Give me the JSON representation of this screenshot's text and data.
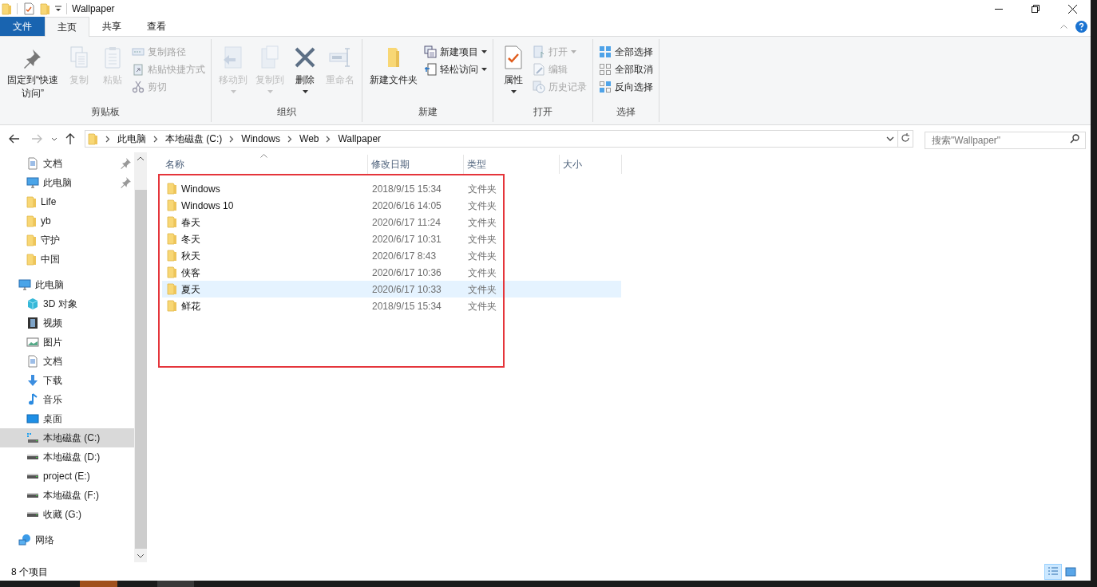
{
  "window": {
    "title": "Wallpaper"
  },
  "ribbon": {
    "tabs": [
      {
        "label": "文件",
        "kind": "file",
        "selected": false
      },
      {
        "label": "主页",
        "kind": "tab",
        "selected": true
      },
      {
        "label": "共享",
        "kind": "tab",
        "selected": false
      },
      {
        "label": "查看",
        "kind": "tab",
        "selected": false
      }
    ],
    "groups": [
      {
        "label": "剪贴板",
        "commands": [
          {
            "label": "固定到“快速访问”",
            "kind": "large",
            "disabled": false,
            "dropdown": false
          },
          {
            "label": "复制",
            "kind": "large",
            "disabled": true,
            "dropdown": false
          },
          {
            "label": "粘贴",
            "kind": "large",
            "disabled": true,
            "dropdown": false
          },
          {
            "label": "复制路径",
            "kind": "small",
            "disabled": true,
            "dropdown": false
          },
          {
            "label": "粘贴快捷方式",
            "kind": "small",
            "disabled": true,
            "dropdown": false
          },
          {
            "label": "剪切",
            "kind": "small",
            "disabled": true,
            "dropdown": false
          }
        ]
      },
      {
        "label": "组织",
        "commands": [
          {
            "label": "移动到",
            "kind": "large",
            "disabled": true,
            "dropdown": true
          },
          {
            "label": "复制到",
            "kind": "large",
            "disabled": true,
            "dropdown": true
          },
          {
            "label": "删除",
            "kind": "large",
            "disabled": false,
            "dropdown": true
          },
          {
            "label": "重命名",
            "kind": "large",
            "disabled": true,
            "dropdown": false
          }
        ]
      },
      {
        "label": "新建",
        "commands": [
          {
            "label": "新建文件夹",
            "kind": "large",
            "disabled": false,
            "dropdown": false
          },
          {
            "label": "新建项目",
            "kind": "small",
            "disabled": false,
            "dropdown": true
          },
          {
            "label": "轻松访问",
            "kind": "small",
            "disabled": false,
            "dropdown": true
          }
        ]
      },
      {
        "label": "打开",
        "commands": [
          {
            "label": "属性",
            "kind": "large",
            "disabled": false,
            "dropdown": true
          },
          {
            "label": "打开",
            "kind": "small",
            "disabled": true,
            "dropdown": true
          },
          {
            "label": "编辑",
            "kind": "small",
            "disabled": true,
            "dropdown": false
          },
          {
            "label": "历史记录",
            "kind": "small",
            "disabled": true,
            "dropdown": false
          }
        ]
      },
      {
        "label": "选择",
        "commands": [
          {
            "label": "全部选择",
            "kind": "small",
            "disabled": false,
            "dropdown": false
          },
          {
            "label": "全部取消",
            "kind": "small",
            "disabled": false,
            "dropdown": false
          },
          {
            "label": "反向选择",
            "kind": "small",
            "disabled": false,
            "dropdown": false
          }
        ]
      }
    ]
  },
  "address": {
    "path": [
      "此电脑",
      "本地磁盘 (C:)",
      "Windows",
      "Web",
      "Wallpaper"
    ],
    "search_placeholder": "搜索\"Wallpaper\""
  },
  "sidebar": {
    "quick_access": [
      {
        "label": "文档",
        "kind": "document",
        "pinned": true,
        "selected": false
      },
      {
        "label": "此电脑",
        "kind": "computer",
        "pinned": true,
        "selected": false
      },
      {
        "label": "Life",
        "kind": "folder",
        "pinned": false,
        "selected": false
      },
      {
        "label": "yb",
        "kind": "folder",
        "pinned": false,
        "selected": false
      },
      {
        "label": "守护",
        "kind": "folder",
        "pinned": false,
        "selected": false
      },
      {
        "label": "中国",
        "kind": "folder",
        "pinned": false,
        "selected": false
      }
    ],
    "items": [
      {
        "label": "此电脑",
        "kind": "computer",
        "selected": false,
        "children": [
          {
            "label": "3D 对象",
            "kind": "cube",
            "selected": false
          },
          {
            "label": "视频",
            "kind": "video",
            "selected": false
          },
          {
            "label": "图片",
            "kind": "picture",
            "selected": false
          },
          {
            "label": "文档",
            "kind": "document",
            "selected": false
          },
          {
            "label": "下载",
            "kind": "download",
            "selected": false
          },
          {
            "label": "音乐",
            "kind": "music",
            "selected": false
          },
          {
            "label": "桌面",
            "kind": "desktop",
            "selected": false
          },
          {
            "label": "本地磁盘 (C:)",
            "kind": "system-drive",
            "selected": true
          },
          {
            "label": "本地磁盘 (D:)",
            "kind": "drive",
            "selected": false
          },
          {
            "label": "project (E:)",
            "kind": "drive",
            "selected": false
          },
          {
            "label": "本地磁盘 (F:)",
            "kind": "drive",
            "selected": false
          },
          {
            "label": "收藏 (G:)",
            "kind": "drive",
            "selected": false
          }
        ]
      },
      {
        "label": "网络",
        "kind": "network",
        "selected": false
      }
    ]
  },
  "file_list": {
    "columns": [
      "名称",
      "修改日期",
      "类型",
      "大小"
    ],
    "rows": [
      {
        "name": "Windows",
        "modified": "2018/9/15 15:34",
        "type": "文件夹",
        "selected": false
      },
      {
        "name": "Windows 10",
        "modified": "2020/6/16 14:05",
        "type": "文件夹",
        "selected": false
      },
      {
        "name": "春天",
        "modified": "2020/6/17 11:24",
        "type": "文件夹",
        "selected": false
      },
      {
        "name": "冬天",
        "modified": "2020/6/17 10:31",
        "type": "文件夹",
        "selected": false
      },
      {
        "name": "秋天",
        "modified": "2020/6/17 8:43",
        "type": "文件夹",
        "selected": false
      },
      {
        "name": "侠客",
        "modified": "2020/6/17 10:36",
        "type": "文件夹",
        "selected": false
      },
      {
        "name": "夏天",
        "modified": "2020/6/17 10:33",
        "type": "文件夹",
        "selected": true
      },
      {
        "name": "鲜花",
        "modified": "2018/9/15 15:34",
        "type": "文件夹",
        "selected": false
      }
    ]
  },
  "status_bar": {
    "item_count": "8 个项目",
    "views": [
      {
        "selected": true
      },
      {
        "selected": false
      }
    ]
  }
}
